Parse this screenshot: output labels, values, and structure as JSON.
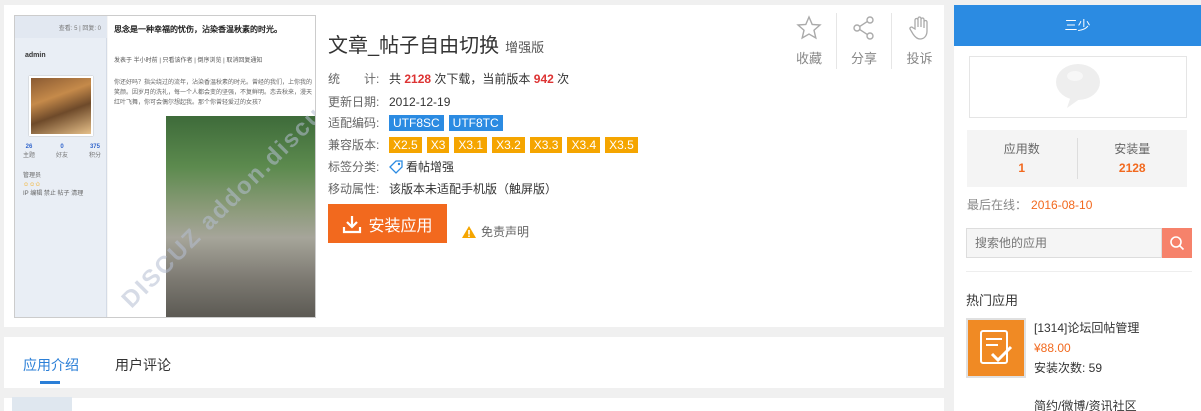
{
  "app": {
    "title": "文章_帖子自由切换",
    "edition": "增强版",
    "stats_label": "统　　计:",
    "stats_prefix": "共",
    "downloads": "2128",
    "stats_mid": "次下载，当前版本",
    "current_version_downloads": "942",
    "stats_suffix": "次",
    "updated_label": "更新日期:",
    "updated_date": "2012-12-19",
    "encoding_label": "适配编码:",
    "encodings": [
      "UTF8SC",
      "UTF8TC"
    ],
    "compat_label": "兼容版本:",
    "compat_versions": [
      "X2.5",
      "X3",
      "X3.1",
      "X3.2",
      "X3.3",
      "X3.4",
      "X3.5"
    ],
    "tags_label": "标签分类:",
    "tag": "看帖增强",
    "mobile_label": "移动属性:",
    "mobile_value": "该版本未适配手机版（触屏版）",
    "install_label": "安装应用",
    "disclaimer_label": "免责声明"
  },
  "preview": {
    "topbar": "查看: 5 | 回复: 0",
    "user": "admin",
    "title": "思念是一种幸福的忧伤，沾染香温秋素的时光。",
    "links": "发表于 半小时前 | 只看该作者 | 倒序浏览 | 取消回复通知",
    "text": "你还好吗？指尖绕过的流年，沾染香温秋素的时光。曾经的我们，上你我的笑颜。因岁月的洗礼，每一个人都会变的坚强，不复鲜明。恋去秋来，漫天红叶飞舞，你可会偶尔想起我。那个你曾轻爱过的女孩？",
    "stats": [
      {
        "num": "26",
        "label": "主题"
      },
      {
        "num": "0",
        "label": "好友"
      },
      {
        "num": "375",
        "label": "积分"
      }
    ],
    "admin_lines": [
      "管理员",
      "IP 编辑 禁止 帖子 清理"
    ],
    "watermark": "DISCUZ addon.discuz.com"
  },
  "actions": [
    {
      "label": "收藏",
      "icon": "star-icon"
    },
    {
      "label": "分享",
      "icon": "share-icon"
    },
    {
      "label": "投诉",
      "icon": "hand-icon"
    }
  ],
  "tabs": [
    {
      "label": "应用介绍",
      "active": true
    },
    {
      "label": "用户评论",
      "active": false
    }
  ],
  "sidebar": {
    "developer": "三少",
    "apps_label": "应用数",
    "apps_count": "1",
    "installs_label": "安装量",
    "installs_count": "2128",
    "last_online_label": "最后在线：",
    "last_online_date": "2016-08-10",
    "search_placeholder": "搜索他的应用",
    "hot_title": "热门应用",
    "hot_apps": [
      {
        "name": "[1314]论坛回帖管理",
        "price": "¥88.00",
        "installs": "安装次数: 59"
      },
      {
        "name": "简约/微博/资讯社区"
      }
    ]
  },
  "colors": {
    "accent": "#2b8be2",
    "install": "#f2691e",
    "highlight": "#d33333",
    "compat_tag": "#f5a500"
  }
}
